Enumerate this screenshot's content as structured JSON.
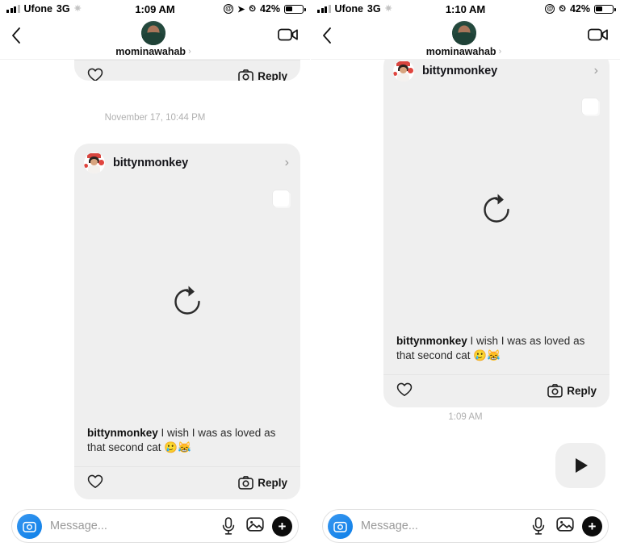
{
  "screens": [
    {
      "id": "left",
      "statusbar": {
        "carrier": "Ufone",
        "network": "3G",
        "time": "1:09 AM",
        "battery_percent": "42%",
        "icons": [
          "signal-bars-icon",
          "activity-spinner-icon",
          "at-circle-icon",
          "location-arrow-icon",
          "alarm-clock-icon",
          "battery-icon"
        ]
      },
      "navbar": {
        "back_icon": "back-chevron-icon",
        "username": "mominawahab",
        "username_chevron": "›",
        "video_icon": "video-camera-icon"
      },
      "top_partial_actions": {
        "heart_icon": "heart-icon",
        "reply_label": "Reply",
        "reply_icon": "camera-icon"
      },
      "divider_timestamp": "November 17, 10:44 PM",
      "post": {
        "author": "bittynmonkey",
        "chevron": "›",
        "media_icon": "reload-icon",
        "overlay_button": "white-square-button",
        "caption_author": "bittynmonkey",
        "caption_text": " I wish I was as loved as that second cat 🥲😹",
        "heart_icon": "heart-icon",
        "reply_label": "Reply",
        "reply_icon": "camera-icon"
      },
      "composer": {
        "camera_icon": "camera-icon",
        "placeholder": "Message...",
        "value": "",
        "mic_icon": "microphone-icon",
        "gallery_icon": "photo-icon",
        "plus_label": "+"
      }
    },
    {
      "id": "right",
      "statusbar": {
        "carrier": "Ufone",
        "network": "3G",
        "time": "1:10 AM",
        "battery_percent": "42%",
        "icons": [
          "signal-bars-icon",
          "activity-spinner-icon",
          "at-circle-icon",
          "alarm-clock-icon",
          "battery-icon"
        ]
      },
      "navbar": {
        "back_icon": "back-chevron-icon",
        "username": "mominawahab",
        "username_chevron": "›",
        "video_icon": "video-camera-icon"
      },
      "post": {
        "author": "bittynmonkey",
        "chevron": "›",
        "media_icon": "reload-icon",
        "overlay_button": "white-square-button",
        "caption_author": "bittynmonkey",
        "caption_text": " I wish I was as loved as that second cat 🥲😹",
        "heart_icon": "heart-icon",
        "reply_label": "Reply",
        "reply_icon": "camera-icon"
      },
      "divider_timestamp": "1:09 AM",
      "play_bubble": {
        "icon": "play-icon"
      },
      "composer": {
        "camera_icon": "camera-icon",
        "placeholder": "Message...",
        "value": "",
        "mic_icon": "microphone-icon",
        "gallery_icon": "photo-icon",
        "plus_label": "+"
      }
    }
  ],
  "colors": {
    "card_bg": "#efefef",
    "accent_blue": "#3897f0",
    "text_primary": "#101010",
    "text_muted": "#b0b0b0",
    "plus_black": "#0c0c0c"
  }
}
